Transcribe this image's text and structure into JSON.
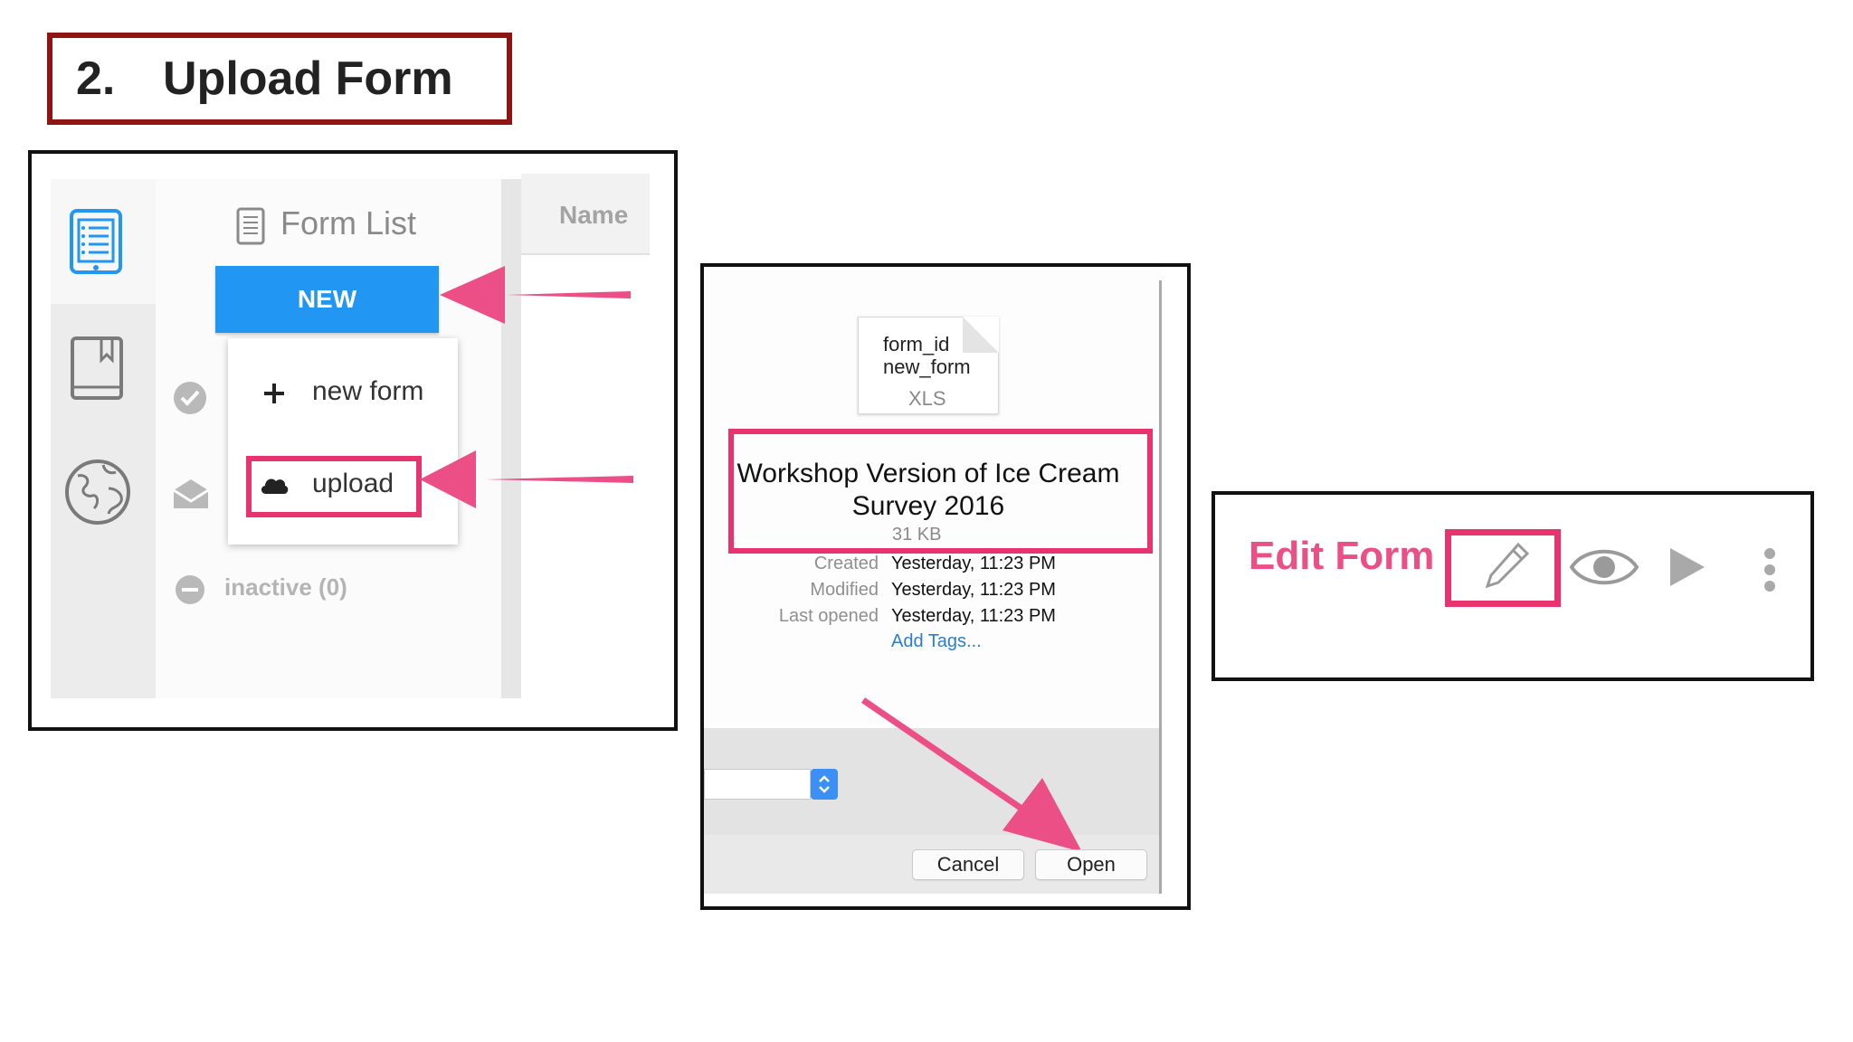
{
  "title": {
    "number": "2.",
    "text": "Upload Form"
  },
  "kobo": {
    "form_list_title": "Form List",
    "name_header": "Name",
    "new_button": "NEW",
    "menu_new_form": "new form",
    "menu_upload": "upload",
    "inactive": "inactive (0)"
  },
  "file_dialog": {
    "file_icon_line1": "form_id",
    "file_icon_line2": "new_form",
    "file_ext": "XLS",
    "file_title": "Workshop Version of Ice Cream Survey 2016",
    "file_size": "31 KB",
    "created_label": "Created",
    "created_value": "Yesterday, 11:23 PM",
    "modified_label": "Modified",
    "modified_value": "Yesterday, 11:23 PM",
    "last_opened_label": "Last opened",
    "last_opened_value": "Yesterday, 11:23 PM",
    "add_tags": "Add Tags...",
    "cancel": "Cancel",
    "open": "Open"
  },
  "edit_panel": {
    "label": "Edit Form"
  },
  "colors": {
    "highlight": "#e8336f",
    "primary": "#2196f3",
    "title_border": "#8f1414"
  },
  "icons": [
    "form-list-icon",
    "library-icon",
    "globe-icon",
    "checkmark-icon",
    "envelope-icon",
    "minus-circle-icon",
    "document-icon",
    "plus-icon",
    "cloud-icon",
    "pencil-icon",
    "eye-icon",
    "play-icon",
    "more-vertical-icon"
  ]
}
